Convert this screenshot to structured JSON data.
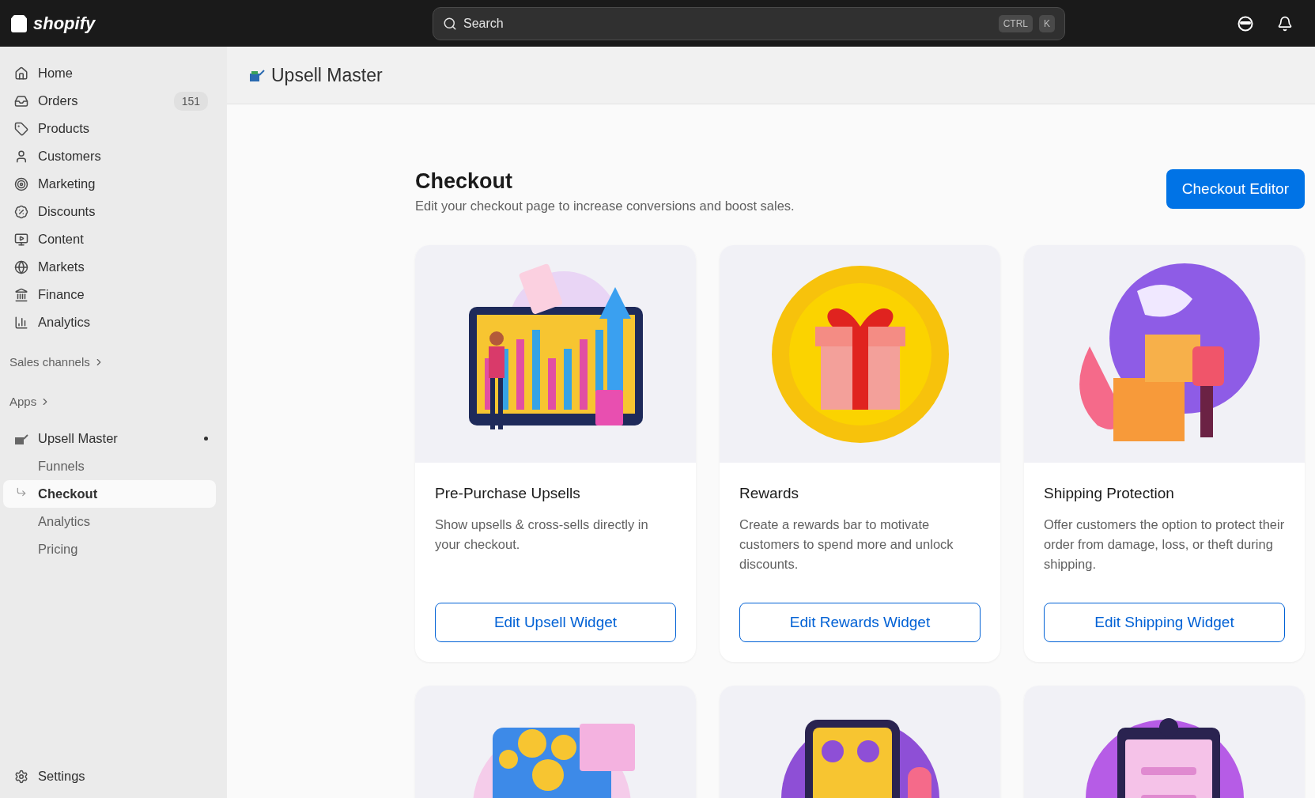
{
  "topbar": {
    "logo": "shopify",
    "search": {
      "placeholder": "Search"
    },
    "shortcut_keys": [
      "CTRL",
      "K"
    ]
  },
  "sidebar": {
    "items": [
      {
        "kind": "home",
        "label": "Home",
        "selected": false
      },
      {
        "kind": "orders",
        "label": "Orders",
        "count": "151",
        "selected": false
      },
      {
        "kind": "products",
        "label": "Products",
        "selected": false
      },
      {
        "kind": "customers",
        "label": "Customers",
        "selected": false
      },
      {
        "kind": "marketing",
        "label": "Marketing",
        "selected": false
      },
      {
        "kind": "discounts",
        "label": "Discounts",
        "selected": false
      },
      {
        "kind": "content",
        "label": "Content",
        "selected": false
      },
      {
        "kind": "markets",
        "label": "Markets",
        "selected": false
      },
      {
        "kind": "finance",
        "label": "Finance",
        "selected": false
      },
      {
        "kind": "analytics",
        "label": "Analytics",
        "selected": false
      }
    ],
    "sections": [
      "Sales channels",
      "Apps"
    ],
    "app": {
      "label": "Upsell Master",
      "children": [
        {
          "label": "Funnels",
          "selected": false
        },
        {
          "label": "Checkout",
          "selected": true
        },
        {
          "label": "Analytics",
          "selected": false
        },
        {
          "label": "Pricing",
          "selected": false
        }
      ]
    },
    "settings": "Settings"
  },
  "app_header": {
    "title": "Upsell Master"
  },
  "page": {
    "title": "Checkout",
    "subtitle": "Edit your checkout page to increase conversions and boost sales.",
    "primary_button": "Checkout Editor"
  },
  "cards": [
    {
      "kind": "upsell",
      "title": "Pre-Purchase Upsells",
      "description": "Show upsells & cross-sells directly in your checkout.",
      "button": "Edit Upsell Widget"
    },
    {
      "kind": "rewards",
      "title": "Rewards",
      "description": "Create a rewards bar to motivate customers to spend more and unlock discounts.",
      "button": "Edit Rewards Widget"
    },
    {
      "kind": "shipping",
      "title": "Shipping Protection",
      "description": "Offer customers the option to protect their order from damage, loss, or theft during shipping.",
      "button": "Edit Shipping Widget"
    },
    {
      "kind": "coins"
    },
    {
      "kind": "cart"
    },
    {
      "kind": "clipboard"
    }
  ]
}
